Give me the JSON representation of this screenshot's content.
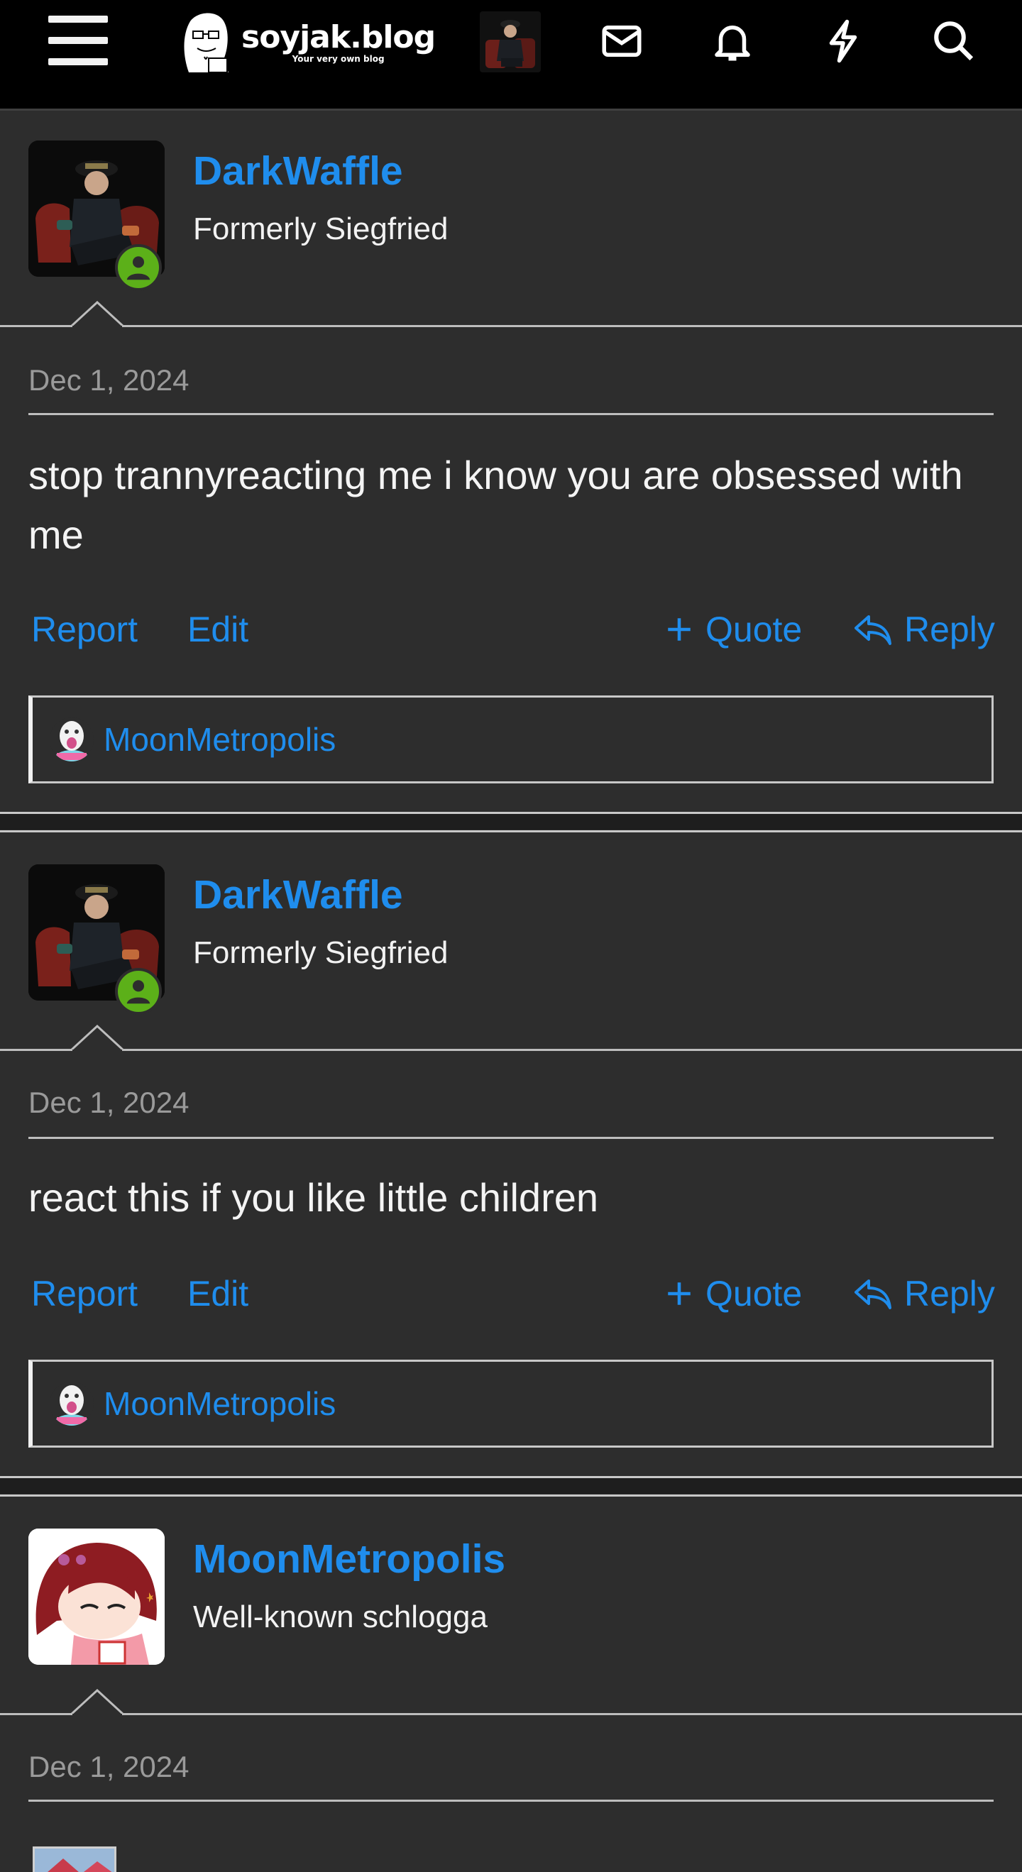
{
  "header": {
    "site_name": "soyjak.blog",
    "site_tagline": "Your very own blog",
    "icons": [
      "menu-icon",
      "envelope-icon",
      "bell-icon",
      "bolt-icon",
      "search-icon"
    ]
  },
  "posts": [
    {
      "username": "DarkWaffle",
      "user_title": "Formerly Siegfried",
      "date": "Dec 1, 2024",
      "body": "stop trannyreacting me i know you are obsessed with me",
      "actions": {
        "report": "Report",
        "edit": "Edit",
        "quote": "Quote",
        "reply": "Reply"
      },
      "reaction_user": "MoonMetropolis"
    },
    {
      "username": "DarkWaffle",
      "user_title": "Formerly Siegfried",
      "date": "Dec 1, 2024",
      "body": "react this if you like little children",
      "actions": {
        "report": "Report",
        "edit": "Edit",
        "quote": "Quote",
        "reply": "Reply"
      },
      "reaction_user": "MoonMetropolis"
    },
    {
      "username": "MoonMetropolis",
      "user_title": "Well-known schlogga",
      "date": "Dec 1, 2024"
    }
  ],
  "colors": {
    "link": "#1f8ded",
    "background": "#2d2d2d",
    "online": "#5cb019",
    "header": "#000000"
  }
}
